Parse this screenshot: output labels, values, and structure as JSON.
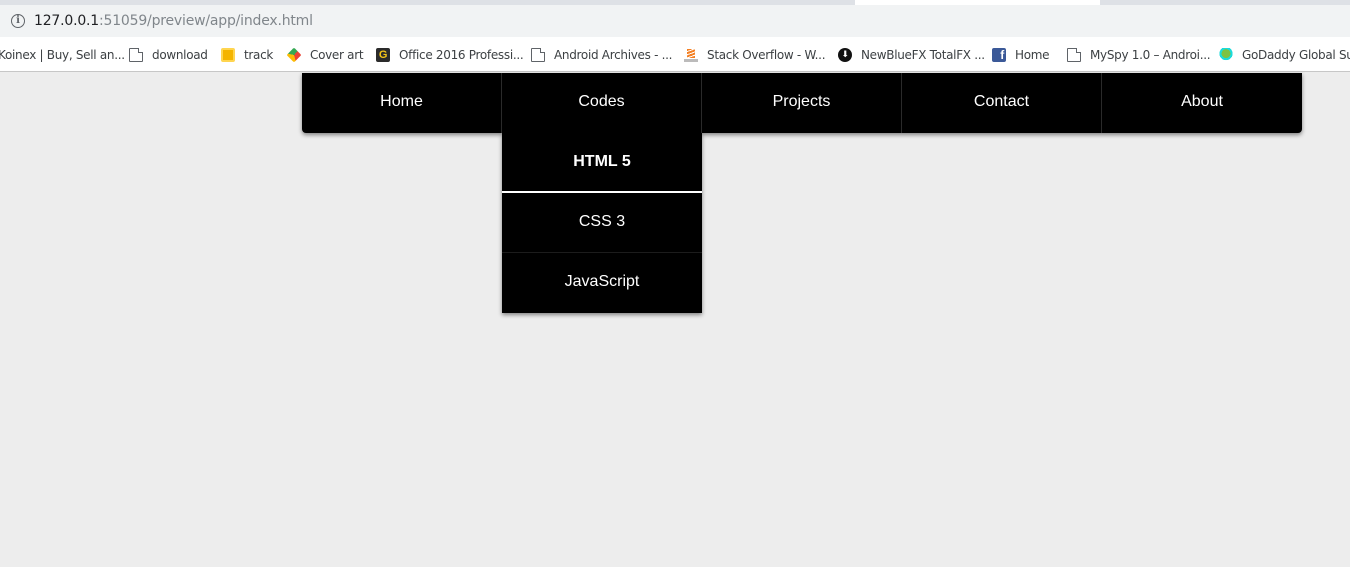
{
  "browser": {
    "url_host": "127.0.0.1",
    "url_rest": ":51059/preview/app/index.html",
    "bookmarks": [
      {
        "label": "Koinex | Buy, Sell an...",
        "icon": "koinex-icon"
      },
      {
        "label": "download",
        "icon": "page-icon"
      },
      {
        "label": "track",
        "icon": "track-icon"
      },
      {
        "label": "Cover art",
        "icon": "google-drive-icon"
      },
      {
        "label": "Office 2016 Professi...",
        "icon": "office-g-icon"
      },
      {
        "label": "Android Archives - ...",
        "icon": "page-icon"
      },
      {
        "label": "Stack Overflow - W...",
        "icon": "stackoverflow-icon"
      },
      {
        "label": "NewBlueFX TotalFX ...",
        "icon": "download-circle-icon"
      },
      {
        "label": "Home",
        "icon": "facebook-icon"
      },
      {
        "label": "MySpy 1.0 – Androi...",
        "icon": "page-icon"
      },
      {
        "label": "GoDaddy Global Su...",
        "icon": "godaddy-icon"
      }
    ]
  },
  "nav": {
    "items": [
      "Home",
      "Codes",
      "Projects",
      "Contact",
      "About"
    ],
    "dropdown": [
      "HTML 5",
      "CSS 3",
      "JavaScript"
    ]
  }
}
